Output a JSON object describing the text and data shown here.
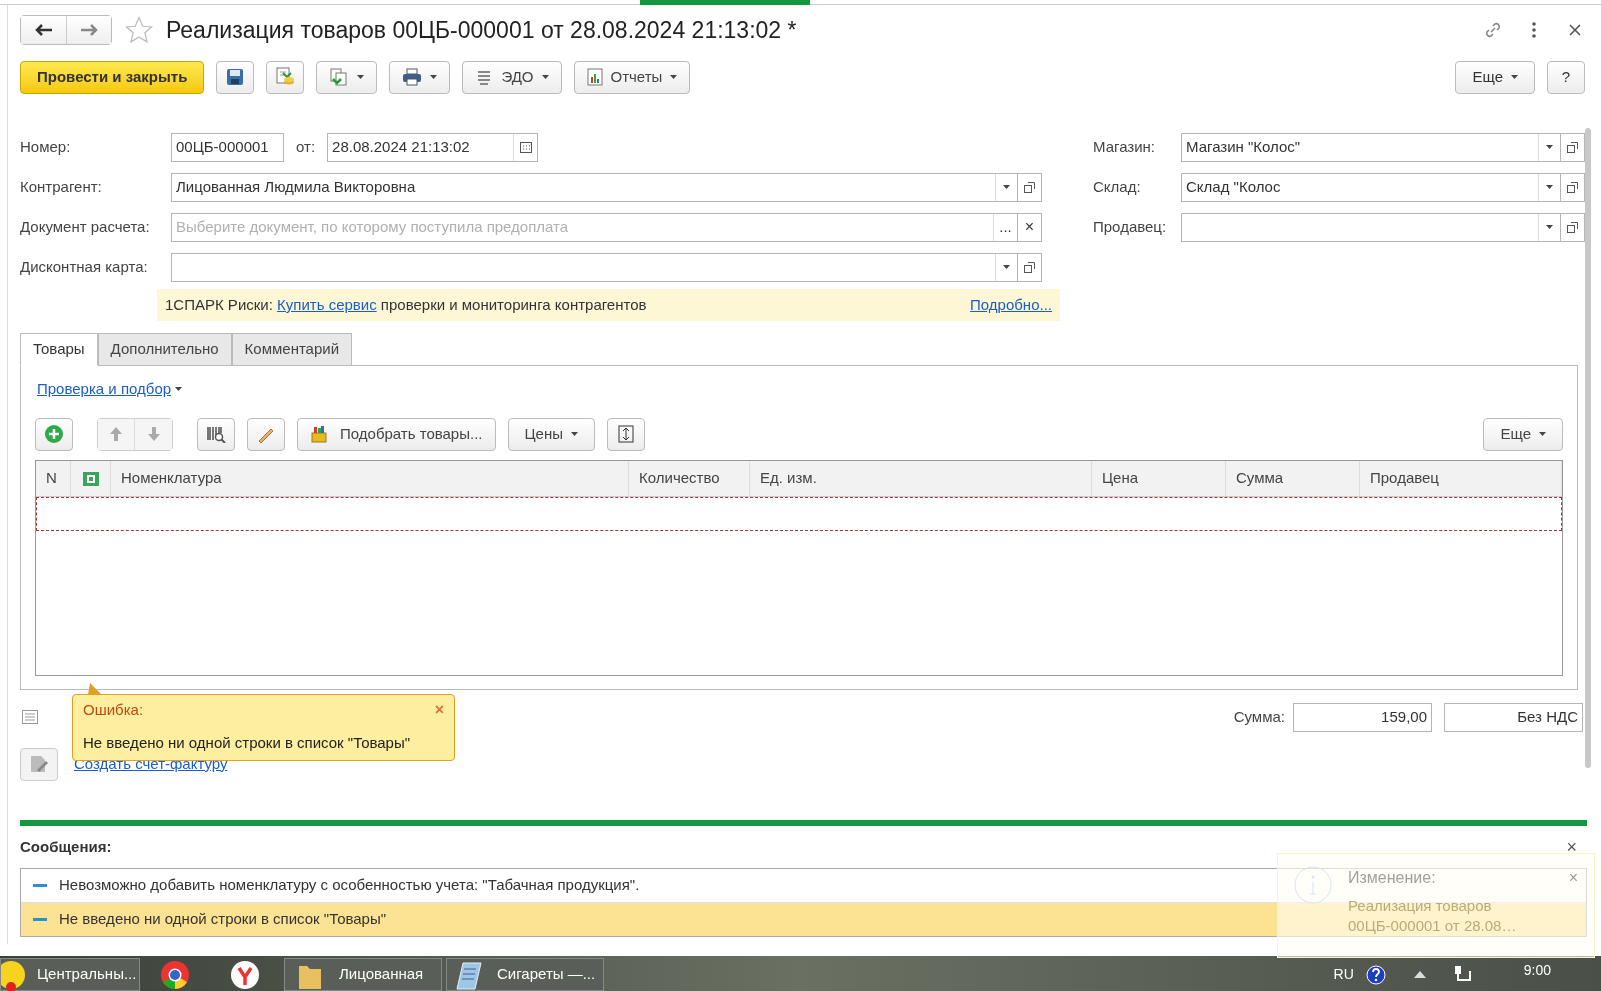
{
  "title": "Реализация товаров 00ЦБ-000001 от 28.08.2024 21:13:02 *",
  "favorite": false,
  "toolbar": [
    {
      "kind": "primary",
      "label": "Провести и закрыть"
    },
    {
      "kind": "icon"
    },
    {
      "kind": "icon"
    },
    {
      "kind": "menu"
    },
    {
      "kind": "menu"
    },
    {
      "kind": "menu",
      "label": "ЭДО"
    },
    {
      "kind": "menu",
      "label": "Отчеты"
    }
  ],
  "more_button": "Еще",
  "help_button": "?",
  "fields_left": [
    {
      "label": "Номер:",
      "kind": "number",
      "value": "00ЦБ-000001",
      "date_label": "от:",
      "date": "28.08.2024 21:13:02"
    },
    {
      "label": "Контрагент:",
      "kind": "select",
      "value": "Лицованная Людмила Викторовна"
    },
    {
      "label": "Документ расчета:",
      "kind": "choice",
      "placeholder": "Выберите документ, по которому поступила предоплата",
      "choice_button": "...",
      "clear_button": "×"
    },
    {
      "label": "Дисконтная карта:",
      "kind": "select"
    }
  ],
  "fields_right": [
    {
      "label": "Магазин:",
      "value": "Магазин \"Колос\""
    },
    {
      "label": "Склад:",
      "value": "Склад \"Колос"
    },
    {
      "label": "Продавец:"
    }
  ],
  "banner": {
    "prefix": "1СПАРК Риски:",
    "link": "Купить сервис",
    "text": "проверки и мониторинга контрагентов",
    "details": "Подробно..."
  },
  "tabs": [
    {
      "label": "Товары",
      "selected": true
    },
    {
      "label": "Дополнительно",
      "selected": false
    },
    {
      "label": "Комментарий",
      "selected": false
    }
  ],
  "check_link": "Проверка и подбор",
  "table_toolbar": {
    "pick": "Подобрать товары...",
    "prices": "Цены",
    "more": "Еще"
  },
  "table": {
    "columns": [
      "N",
      "",
      "Номенклатура",
      "Количество",
      "Ед. изм.",
      "Цена",
      "Сумма",
      "Продавец"
    ]
  },
  "tooltip": {
    "title": "Ошибка:",
    "text": "Не введено ни одной строки в список \"Товары\"",
    "close": "×"
  },
  "totals": {
    "label": "Сумма:",
    "value": "159,00",
    "vat": "Без НДС"
  },
  "invoice_link": "Создать счет-фактуру",
  "messages": {
    "title": "Сообщения:",
    "close": "×",
    "items": [
      {
        "text": "Невозможно добавить номенклатуру с особенностью учета: \"Табачная продукция\".",
        "selected": false
      },
      {
        "text": "Не введено ни одной строки в список \"Товары\"",
        "selected": true
      }
    ]
  },
  "notification": {
    "title": "Изменение:",
    "text": "Реализация товаров 00ЦБ-000001 от 28.08…",
    "close": "×"
  },
  "taskbar": [
    {
      "kind": "app",
      "label": "Центральны..."
    },
    {
      "kind": "chrome"
    },
    {
      "kind": "yandex"
    },
    {
      "kind": "folder",
      "label": "Лицованная"
    },
    {
      "kind": "notepad",
      "label": "Сигареты —..."
    }
  ],
  "tray": {
    "lang": "RU",
    "time": "9:00"
  }
}
